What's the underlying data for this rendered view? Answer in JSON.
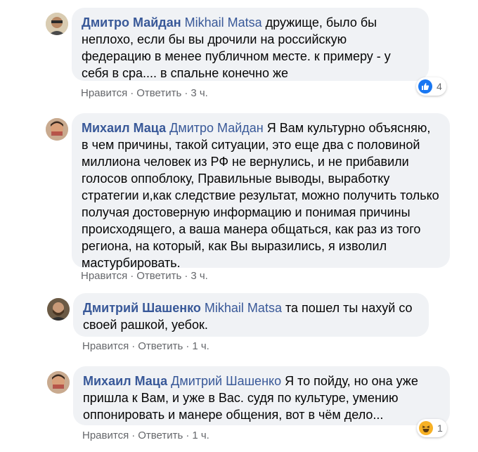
{
  "comments": [
    {
      "author": "Дмитро Майдан",
      "mention": "Mikhail Matsa",
      "text": " дружище, было бы неплохо, если бы вы дрочили на российскую федерацию в менее публичном месте. к примеру - у себя в сра.... в спальне конечно же",
      "like": "Нравится",
      "reply": "Ответить",
      "time": "3 ч.",
      "reaction": {
        "icon": "like-icon",
        "count": "4",
        "color": "#1877f2"
      }
    },
    {
      "author": "Михаил Маца",
      "mention": "Дмитро Майдан",
      "text": " Я Вам культурно объясняю, в чем причины, такой ситуации, это еще два с половиной миллиона человек из РФ не вернулись, и не прибавили голосов оппоблоку, Правильные выводы, выработку стратегии и,как следствие результат, можно получить только получая достоверную информацию и понимая причины происходящего, а ваша манера общаться, как раз из того региона, на который, как Вы выразились, я изволил мастурбировать.",
      "like": "Нравится",
      "reply": "Ответить",
      "time": "3 ч."
    },
    {
      "author": "Дмитрий Шашенко",
      "mention": "Mikhail Matsa",
      "text": " та пошел ты нахуй со своей рашкой, уебок.",
      "like": "Нравится",
      "reply": "Ответить",
      "time": "1 ч."
    },
    {
      "author": "Михаил Маца",
      "mention": "Дмитрий Шашенко",
      "text": " Я то пойду, но она уже пришла к Вам, и уже в Вас. судя по культуре, умению оппонировать и манере общения, вот в чём дело...",
      "like": "Нравится",
      "reply": "Ответить",
      "time": "1 ч.",
      "reaction": {
        "icon": "haha-icon",
        "count": "1",
        "color": "#f7b125"
      }
    }
  ],
  "separator": "·"
}
